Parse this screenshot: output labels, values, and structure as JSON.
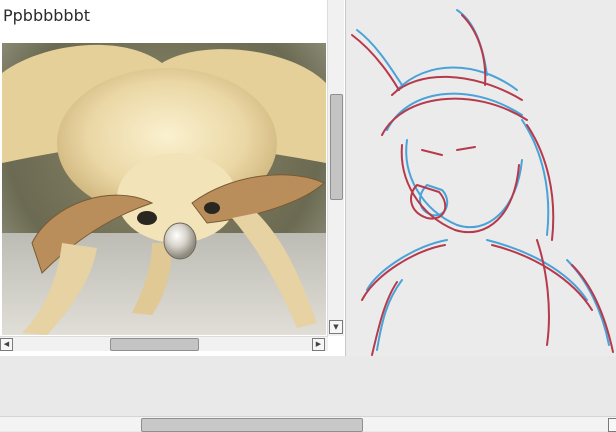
{
  "reference_panel": {
    "title": "Ppbbbbbbt",
    "image_icon": "moth-photo"
  },
  "scroll_glyphs": {
    "down": "▼",
    "left": "◀",
    "right": "▶"
  },
  "canvas": {
    "sketch_icon": "character-sketch",
    "colors": {
      "red_line": "#b63a4c",
      "blue_line": "#4aa3d8"
    }
  }
}
